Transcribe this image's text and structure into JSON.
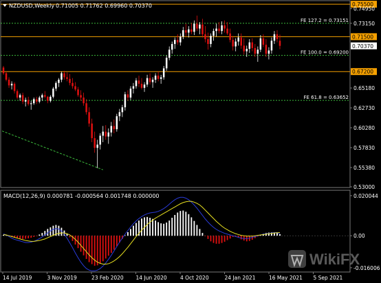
{
  "header": {
    "symbol": "NZDUSD,Weekly",
    "ohlc": "0.71005 0.71762 0.69960 0.70370"
  },
  "macd_header": "MACD(12,26,9) 0.000781 -0.000564 0.001748 0.000000",
  "watermark": "WikiFX",
  "colors": {
    "background": "#000000",
    "bull": "#ffffff",
    "bear": "#e01010",
    "orange_line": "#f5a000",
    "fib_line": "#3cbd3c",
    "macd_line": "#2a3bd8",
    "signal_line": "#e8e020",
    "price_tag_orange": "#f5a000",
    "price_tag_current": "#ffffff"
  },
  "chart_data": [
    {
      "type": "candlestick",
      "title": "NZDUSD,Weekly",
      "ylim": [
        0.53,
        0.7585
      ],
      "y_ticks": [
        "0.74950",
        "0.73150",
        "0.70370",
        "0.67220",
        "0.65180",
        "0.62730",
        "0.60280",
        "0.57830",
        "0.55380",
        "0.53000"
      ],
      "x_ticks": [
        "14 Jul 2019",
        "3 Nov 2019",
        "23 Feb 2020",
        "14 Jun 2020",
        "4 Oct 2020",
        "24 Jan 2021",
        "16 May 2021",
        "5 Sep 2021"
      ],
      "levels": [
        {
          "label": "0.75500",
          "value": 0.755,
          "style": "orange",
          "tag": "0.75500"
        },
        {
          "label": "FE 127.2 = 0.73151",
          "value": 0.73151,
          "style": "fib"
        },
        {
          "label": "0.71500",
          "value": 0.715,
          "style": "orange",
          "tag": "0.71500"
        },
        {
          "label": "current",
          "value": 0.7037,
          "style": "current",
          "tag": "0.70370"
        },
        {
          "label": "FE 100.0 = 0.69200",
          "value": 0.692,
          "style": "fib"
        },
        {
          "label": "0.67200",
          "value": 0.672,
          "style": "orange",
          "tag": "0.67200"
        },
        {
          "label": "FE 61.8 = 0.63652",
          "value": 0.63652,
          "style": "fib"
        }
      ],
      "trendline": {
        "from": [
          0,
          0.5988
        ],
        "to": [
          36,
          0.551
        ]
      },
      "candles": [
        [
          0.677,
          0.679,
          0.668,
          0.67
        ],
        [
          0.67,
          0.672,
          0.66,
          0.662
        ],
        [
          0.662,
          0.665,
          0.652,
          0.655
        ],
        [
          0.655,
          0.66,
          0.65,
          0.657
        ],
        [
          0.657,
          0.659,
          0.645,
          0.648
        ],
        [
          0.648,
          0.65,
          0.638,
          0.64
        ],
        [
          0.64,
          0.645,
          0.636,
          0.643
        ],
        [
          0.643,
          0.646,
          0.632,
          0.635
        ],
        [
          0.635,
          0.64,
          0.629,
          0.637
        ],
        [
          0.637,
          0.641,
          0.63,
          0.632
        ],
        [
          0.632,
          0.636,
          0.625,
          0.633
        ],
        [
          0.633,
          0.64,
          0.631,
          0.638
        ],
        [
          0.638,
          0.641,
          0.632,
          0.635
        ],
        [
          0.635,
          0.642,
          0.633,
          0.64
        ],
        [
          0.64,
          0.645,
          0.636,
          0.643
        ],
        [
          0.643,
          0.648,
          0.639,
          0.641
        ],
        [
          0.641,
          0.642,
          0.633,
          0.636
        ],
        [
          0.636,
          0.643,
          0.634,
          0.641
        ],
        [
          0.641,
          0.653,
          0.639,
          0.651
        ],
        [
          0.651,
          0.66,
          0.648,
          0.658
        ],
        [
          0.658,
          0.664,
          0.653,
          0.662
        ],
        [
          0.662,
          0.672,
          0.659,
          0.67
        ],
        [
          0.67,
          0.673,
          0.662,
          0.665
        ],
        [
          0.665,
          0.671,
          0.66,
          0.663
        ],
        [
          0.663,
          0.669,
          0.655,
          0.658
        ],
        [
          0.658,
          0.664,
          0.651,
          0.654
        ],
        [
          0.654,
          0.659,
          0.648,
          0.65
        ],
        [
          0.65,
          0.653,
          0.641,
          0.643
        ],
        [
          0.643,
          0.649,
          0.636,
          0.64
        ],
        [
          0.64,
          0.646,
          0.63,
          0.633
        ],
        [
          0.633,
          0.638,
          0.619,
          0.622
        ],
        [
          0.622,
          0.628,
          0.604,
          0.608
        ],
        [
          0.608,
          0.614,
          0.585,
          0.59
        ],
        [
          0.59,
          0.598,
          0.572,
          0.578
        ],
        [
          0.578,
          0.588,
          0.553,
          0.582
        ],
        [
          0.582,
          0.596,
          0.576,
          0.593
        ],
        [
          0.593,
          0.605,
          0.585,
          0.598
        ],
        [
          0.598,
          0.606,
          0.588,
          0.592
        ],
        [
          0.592,
          0.602,
          0.583,
          0.597
        ],
        [
          0.597,
          0.61,
          0.592,
          0.605
        ],
        [
          0.605,
          0.613,
          0.596,
          0.601
        ],
        [
          0.601,
          0.62,
          0.598,
          0.617
        ],
        [
          0.617,
          0.626,
          0.611,
          0.622
        ],
        [
          0.622,
          0.631,
          0.616,
          0.628
        ],
        [
          0.628,
          0.647,
          0.624,
          0.644
        ],
        [
          0.644,
          0.649,
          0.636,
          0.64
        ],
        [
          0.64,
          0.654,
          0.637,
          0.651
        ],
        [
          0.651,
          0.658,
          0.645,
          0.654
        ],
        [
          0.654,
          0.664,
          0.651,
          0.661
        ],
        [
          0.661,
          0.667,
          0.653,
          0.657
        ],
        [
          0.657,
          0.664,
          0.65,
          0.652
        ],
        [
          0.652,
          0.659,
          0.647,
          0.656
        ],
        [
          0.656,
          0.668,
          0.653,
          0.664
        ],
        [
          0.664,
          0.67,
          0.656,
          0.659
        ],
        [
          0.659,
          0.665,
          0.652,
          0.662
        ],
        [
          0.662,
          0.67,
          0.658,
          0.667
        ],
        [
          0.667,
          0.672,
          0.66,
          0.663
        ],
        [
          0.663,
          0.668,
          0.657,
          0.665
        ],
        [
          0.665,
          0.679,
          0.662,
          0.676
        ],
        [
          0.676,
          0.692,
          0.673,
          0.689
        ],
        [
          0.689,
          0.703,
          0.686,
          0.699
        ],
        [
          0.699,
          0.709,
          0.694,
          0.706
        ],
        [
          0.706,
          0.714,
          0.7,
          0.711
        ],
        [
          0.711,
          0.718,
          0.705,
          0.708
        ],
        [
          0.708,
          0.719,
          0.704,
          0.715
        ],
        [
          0.715,
          0.727,
          0.712,
          0.723
        ],
        [
          0.723,
          0.731,
          0.716,
          0.72
        ],
        [
          0.72,
          0.728,
          0.714,
          0.724
        ],
        [
          0.724,
          0.732,
          0.718,
          0.721
        ],
        [
          0.721,
          0.735,
          0.717,
          0.731
        ],
        [
          0.731,
          0.741,
          0.722,
          0.725
        ],
        [
          0.725,
          0.733,
          0.718,
          0.73
        ],
        [
          0.73,
          0.737,
          0.714,
          0.718
        ],
        [
          0.718,
          0.728,
          0.708,
          0.712
        ],
        [
          0.712,
          0.72,
          0.699,
          0.706
        ],
        [
          0.706,
          0.719,
          0.702,
          0.716
        ],
        [
          0.716,
          0.725,
          0.71,
          0.722
        ],
        [
          0.722,
          0.731,
          0.715,
          0.725
        ],
        [
          0.725,
          0.733,
          0.719,
          0.722
        ],
        [
          0.722,
          0.734,
          0.718,
          0.729
        ],
        [
          0.729,
          0.735,
          0.72,
          0.725
        ],
        [
          0.725,
          0.733,
          0.717,
          0.719
        ],
        [
          0.719,
          0.725,
          0.708,
          0.711
        ],
        [
          0.711,
          0.716,
          0.698,
          0.703
        ],
        [
          0.703,
          0.713,
          0.697,
          0.709
        ],
        [
          0.709,
          0.719,
          0.704,
          0.714
        ],
        [
          0.714,
          0.719,
          0.7,
          0.704
        ],
        [
          0.704,
          0.713,
          0.693,
          0.697
        ],
        [
          0.697,
          0.704,
          0.69,
          0.7
        ],
        [
          0.7,
          0.712,
          0.695,
          0.708
        ],
        [
          0.708,
          0.713,
          0.697,
          0.701
        ],
        [
          0.701,
          0.706,
          0.69,
          0.694
        ],
        [
          0.694,
          0.703,
          0.684,
          0.699
        ],
        [
          0.699,
          0.717,
          0.696,
          0.713
        ],
        [
          0.713,
          0.718,
          0.702,
          0.705
        ],
        [
          0.705,
          0.712,
          0.69,
          0.694
        ],
        [
          0.694,
          0.702,
          0.687,
          0.698
        ],
        [
          0.698,
          0.714,
          0.694,
          0.71
        ],
        [
          0.71,
          0.722,
          0.706,
          0.718
        ],
        [
          0.718,
          0.723,
          0.708,
          0.712
        ],
        [
          0.71,
          0.7176,
          0.6996,
          0.7037
        ]
      ]
    },
    {
      "type": "macd",
      "title": "MACD(12,26,9)",
      "ylim": [
        -0.0178,
        0.0224
      ],
      "y_ticks": [
        "0.020044",
        "0.00",
        "-0.016006"
      ],
      "histogram": [
        0.0004,
        0.0002,
        -0.0002,
        -0.0006,
        -0.0009,
        -0.0012,
        -0.0014,
        -0.0016,
        -0.0015,
        -0.0013,
        -0.001,
        -0.0006,
        -0.0002,
        0.0006,
        0.0014,
        0.0024,
        0.0034,
        0.0042,
        0.005,
        0.0054,
        0.005,
        0.004,
        0.0026,
        0.001,
        -0.0008,
        -0.0026,
        -0.0044,
        -0.0062,
        -0.008,
        -0.0098,
        -0.0116,
        -0.0132,
        -0.0142,
        -0.015,
        -0.0148,
        -0.014,
        -0.0128,
        -0.0114,
        -0.01,
        -0.0086,
        -0.007,
        -0.0052,
        -0.0034,
        -0.0016,
        0.0002,
        0.0018,
        0.0034,
        0.005,
        0.0064,
        0.0076,
        0.0086,
        0.0092,
        0.0094,
        0.009,
        0.0084,
        0.0076,
        0.0068,
        0.0062,
        0.006,
        0.0066,
        0.0076,
        0.009,
        0.0104,
        0.0116,
        0.0124,
        0.0126,
        0.012,
        0.0108,
        0.0092,
        0.0074,
        0.0054,
        0.0034,
        0.0014,
        -0.0002,
        -0.0016,
        -0.0028,
        -0.0036,
        -0.004,
        -0.004,
        -0.0036,
        -0.003,
        -0.0022,
        -0.0014,
        -0.0006,
        -0.0004,
        -0.001,
        -0.0018,
        -0.0024,
        -0.0028,
        -0.0026,
        -0.002,
        -0.0012,
        -0.0004,
        0.0004,
        0.001,
        0.0014,
        0.0016,
        0.0017,
        0.0018,
        0.0016,
        0.0008
      ],
      "macd": [
        0.001,
        0.0004,
        -0.0004,
        -0.0012,
        -0.0018,
        -0.0022,
        -0.0026,
        -0.003,
        -0.0034,
        -0.0034,
        -0.0032,
        -0.0028,
        -0.0022,
        -0.0014,
        -0.0006,
        0.0004,
        0.0014,
        0.0024,
        0.0032,
        0.0036,
        0.0034,
        0.0024,
        0.0008,
        -0.0012,
        -0.0036,
        -0.006,
        -0.0086,
        -0.011,
        -0.0132,
        -0.015,
        -0.0164,
        -0.0172,
        -0.0176,
        -0.0176,
        -0.0172,
        -0.0164,
        -0.0152,
        -0.0136,
        -0.0118,
        -0.0098,
        -0.0076,
        -0.0054,
        -0.0032,
        -0.0012,
        0.0008,
        0.0026,
        0.0044,
        0.006,
        0.0074,
        0.0086,
        0.0096,
        0.0104,
        0.011,
        0.0114,
        0.0116,
        0.0118,
        0.0122,
        0.0128,
        0.0136,
        0.0146,
        0.0158,
        0.017,
        0.018,
        0.0188,
        0.0192,
        0.0192,
        0.0188,
        0.018,
        0.0168,
        0.0154,
        0.0138,
        0.012,
        0.0102,
        0.0084,
        0.0068,
        0.0054,
        0.0042,
        0.0032,
        0.0024,
        0.0018,
        0.0012,
        0.0008,
        0.0004,
        0.0,
        -0.0004,
        -0.0008,
        -0.0012,
        -0.0014,
        -0.0014,
        -0.0012,
        -0.0008,
        -0.0004,
        0.0,
        0.0004,
        0.0008,
        0.001,
        0.0012,
        0.0014,
        0.0016,
        0.0016,
        0.0008
      ],
      "signal": [
        0.0006,
        0.0004,
        0.0,
        -0.0004,
        -0.0008,
        -0.0012,
        -0.0016,
        -0.002,
        -0.0024,
        -0.0026,
        -0.0028,
        -0.0028,
        -0.0026,
        -0.0024,
        -0.002,
        -0.0016,
        -0.001,
        -0.0004,
        0.0002,
        0.0008,
        0.0012,
        0.0014,
        0.0014,
        0.001,
        0.0004,
        -0.0006,
        -0.0018,
        -0.0032,
        -0.0048,
        -0.0064,
        -0.008,
        -0.0096,
        -0.011,
        -0.0122,
        -0.0132,
        -0.0138,
        -0.0142,
        -0.0142,
        -0.014,
        -0.0134,
        -0.0126,
        -0.0116,
        -0.0104,
        -0.009,
        -0.0074,
        -0.0058,
        -0.004,
        -0.0022,
        -0.0004,
        0.0012,
        0.0028,
        0.0042,
        0.0056,
        0.0068,
        0.0078,
        0.0088,
        0.0096,
        0.0104,
        0.0112,
        0.012,
        0.0128,
        0.0136,
        0.0144,
        0.0152,
        0.016,
        0.0166,
        0.017,
        0.0172,
        0.0172,
        0.0168,
        0.0162,
        0.0154,
        0.0142,
        0.0128,
        0.0114,
        0.01,
        0.0086,
        0.0072,
        0.006,
        0.0048,
        0.0038,
        0.003,
        0.0022,
        0.0016,
        0.001,
        0.0006,
        0.0002,
        0.0,
        -0.0002,
        -0.0002,
        -0.0002,
        0.0,
        0.0002,
        0.0004,
        0.0006,
        0.0008,
        0.001,
        0.0012,
        0.0014,
        0.0015,
        0.0016
      ]
    }
  ]
}
